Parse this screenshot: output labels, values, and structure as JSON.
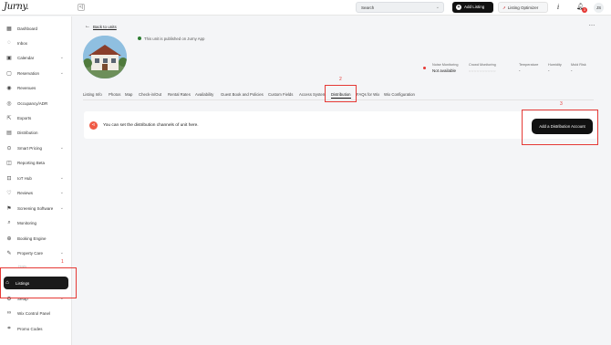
{
  "header": {
    "logo": "Jurny.",
    "collapse_icon": "<|",
    "search_label": "Search",
    "add_listing_label": "Add Listing",
    "optimizer_label": "Listing Optimizer",
    "info_label": "i",
    "notification_count": "3",
    "avatar_initials": "JS"
  },
  "sidebar": {
    "items": [
      {
        "label": "Dashboard",
        "icon": "grid-icon",
        "expandable": false
      },
      {
        "label": "Inbox",
        "icon": "chat-icon",
        "expandable": false
      },
      {
        "label": "Calendar",
        "icon": "calendar-icon",
        "expandable": true
      },
      {
        "label": "Reservation",
        "icon": "suitcase-icon",
        "expandable": true
      },
      {
        "label": "Revenues",
        "icon": "money-icon",
        "expandable": false
      },
      {
        "label": "Occupancy/ADR",
        "icon": "check-circle-icon",
        "expandable": false
      },
      {
        "label": "Exports",
        "icon": "export-icon",
        "expandable": false
      },
      {
        "label": "Distribution",
        "icon": "distribution-icon",
        "expandable": false
      },
      {
        "label": "Smart Pricing",
        "icon": "pricing-icon",
        "expandable": true
      },
      {
        "label": "Reporting Beta",
        "icon": "report-icon",
        "expandable": false
      },
      {
        "label": "IoT Hub",
        "icon": "iot-icon",
        "expandable": true
      },
      {
        "label": "Reviews",
        "icon": "heart-icon",
        "expandable": true
      },
      {
        "label": "Screening Software",
        "icon": "flag-icon",
        "expandable": true
      },
      {
        "label": "Monitoring",
        "icon": "search-icon",
        "expandable": false
      },
      {
        "label": "Booking Engine",
        "icon": "globe-icon",
        "expandable": false
      },
      {
        "label": "Property Care",
        "icon": "wrench-icon",
        "expandable": true
      },
      {
        "label": "Hosts",
        "icon": "user-icon",
        "expandable": false
      },
      {
        "label": "Listings",
        "icon": "home-icon",
        "expandable": false
      },
      {
        "label": "Setup",
        "icon": "gear-icon",
        "expandable": true
      },
      {
        "label": "Wix Control Panel",
        "icon": "link-icon",
        "expandable": false
      },
      {
        "label": "Promo Codes",
        "icon": "tag-icon",
        "expandable": false
      }
    ]
  },
  "main": {
    "back_label": "Back to units",
    "published_text": "This unit is published on Jurny App",
    "metrics": {
      "noise": {
        "label": "Noise Monitoring",
        "value": "Not available"
      },
      "crowd": {
        "label": "Crowd Monitoring"
      },
      "temperature": {
        "label": "Temperature",
        "value": "-"
      },
      "humidity": {
        "label": "Humidity",
        "value": "-"
      },
      "mold": {
        "label": "Mold Risk",
        "value": "-"
      }
    },
    "tabs": [
      "Listing Info",
      "Photos",
      "Map",
      "Check-in/Out",
      "Rental Rates",
      "Availability",
      "Guest Book and Policies",
      "Custom Fields",
      "Access System",
      "Distribution",
      "FAQs for Wix",
      "Wix Configuration"
    ],
    "active_tab": "Distribution",
    "distribution_message": "You can set the distribution channels of unit here.",
    "add_distribution_label": "Add a Distribution Account"
  },
  "annotations": {
    "labels": [
      "1",
      "2",
      "3"
    ],
    "color": "#e53935"
  },
  "colors": {
    "accent": "#111111",
    "annotation": "#e53935",
    "share_icon": "#f05a45",
    "published": "#2e7d32"
  }
}
